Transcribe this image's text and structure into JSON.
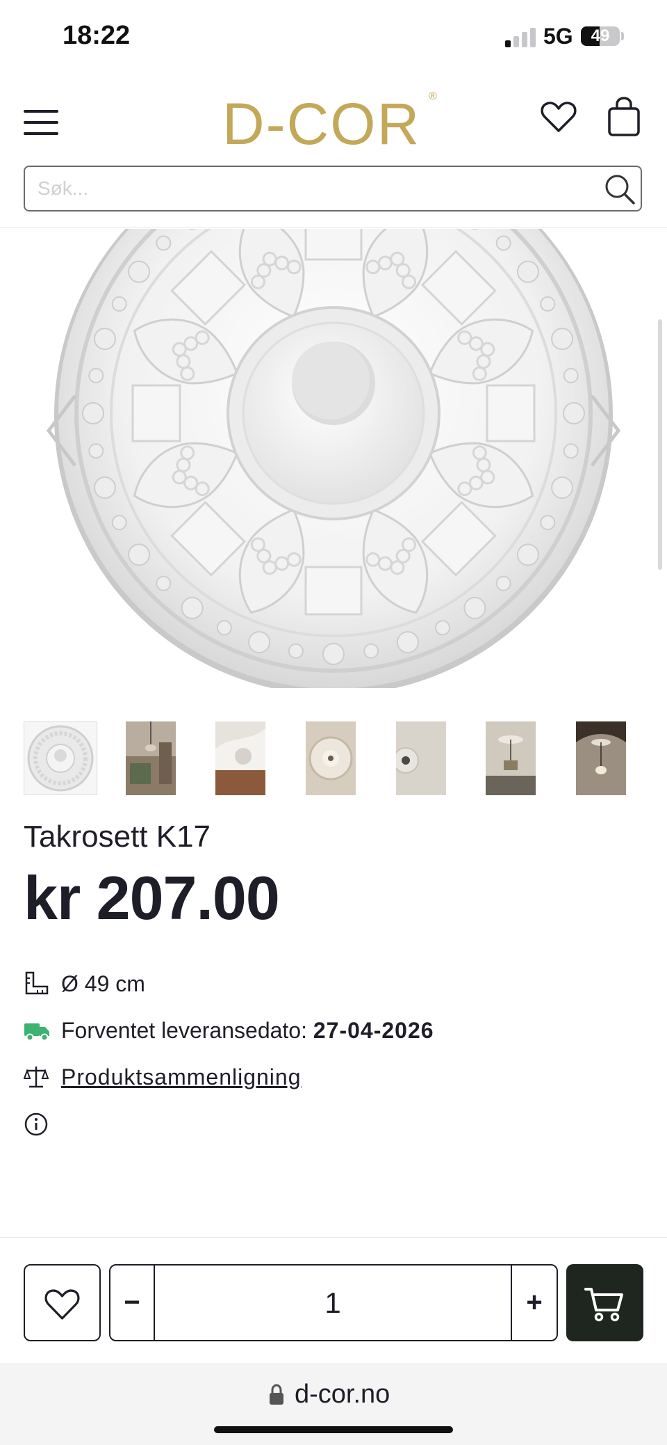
{
  "status_bar": {
    "time": "18:22",
    "network": "5G",
    "battery": "49",
    "battery_level": 0.49,
    "signal_bars_active": 1,
    "signal_bars_total": 4
  },
  "header": {
    "logo": "D-COR",
    "logo_mark": "®",
    "menu_icon": "hamburger-menu-icon",
    "wishlist_icon": "heart-icon",
    "bag_icon": "shopping-bag-icon",
    "brand_color": "#c4a85a"
  },
  "search": {
    "placeholder": "Søk...",
    "value": "",
    "icon": "search-icon"
  },
  "gallery": {
    "current_index": 0,
    "prev_icon": "chevron-left-icon",
    "next_icon": "chevron-right-icon",
    "thumbnail_count": 7
  },
  "product": {
    "title": "Takrosett K17",
    "price": "kr 207.00",
    "dimension": "Ø 49 cm",
    "delivery_label": "Forventet leveransedato:",
    "delivery_date": "27-04-2026",
    "compare_link": "Produktsammenligning",
    "delivery_color": "#3cb371"
  },
  "cart_controls": {
    "minus_label": "−",
    "quantity": "1",
    "plus_label": "+",
    "fav_icon": "heart-icon",
    "cart_icon": "cart-icon",
    "cart_bg": "#1f2620"
  },
  "browser": {
    "url": "d-cor.no",
    "lock_icon": "lock-icon"
  }
}
